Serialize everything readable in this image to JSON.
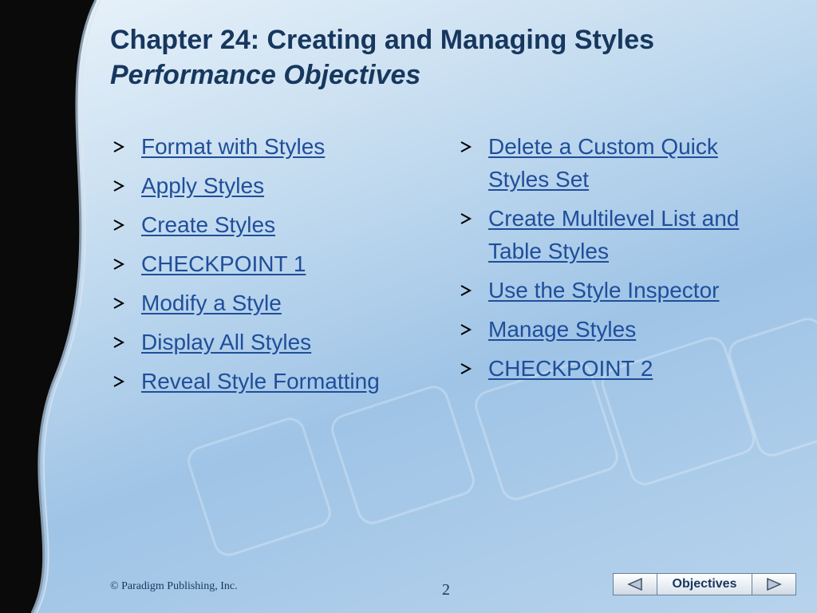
{
  "slide": {
    "title": "Chapter 24: Creating and Managing Styles",
    "subtitle": "Performance Objectives"
  },
  "objectives_left": [
    "Format with Styles",
    "Apply Styles",
    "Create Styles",
    "CHECKPOINT 1",
    "Modify a Style",
    "Display All Styles",
    "Reveal Style Formatting"
  ],
  "objectives_right": [
    "Delete a Custom Quick Styles Set",
    "Create Multilevel List and Table Styles",
    "Use the Style Inspector",
    "Manage Styles",
    "CHECKPOINT 2"
  ],
  "footer": {
    "copyright": "© Paradigm Publishing, Inc.",
    "page_number": "2"
  },
  "nav": {
    "label": "Objectives",
    "prev_icon": "triangle-left-icon",
    "next_icon": "triangle-right-icon"
  },
  "colors": {
    "title": "#17375e",
    "link": "#1f4e9a",
    "background": "#b7d3ec"
  }
}
